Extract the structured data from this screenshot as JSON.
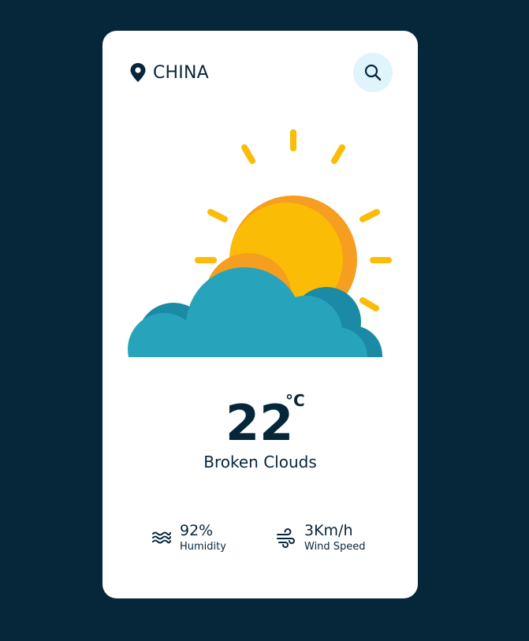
{
  "location": {
    "name": "CHINA",
    "icon": "map-pin-icon"
  },
  "search": {
    "icon": "search-icon"
  },
  "weather": {
    "icon": "sun-behind-cloud-icon",
    "temperature": "22",
    "unit": "°C",
    "condition": "Broken Clouds"
  },
  "stats": {
    "humidity": {
      "value": "92%",
      "label": "Humidity",
      "icon": "waves-icon"
    },
    "wind": {
      "value": "3Km/h",
      "label": "Wind Speed",
      "icon": "wind-icon"
    }
  },
  "colors": {
    "background": "#06263a",
    "card": "#ffffff",
    "search_bg": "#dff4fb",
    "sun": "#fbbc05",
    "sun_shade": "#f59e1f",
    "cloud": "#27a4bc",
    "cloud_shade": "#1a8aa5"
  }
}
